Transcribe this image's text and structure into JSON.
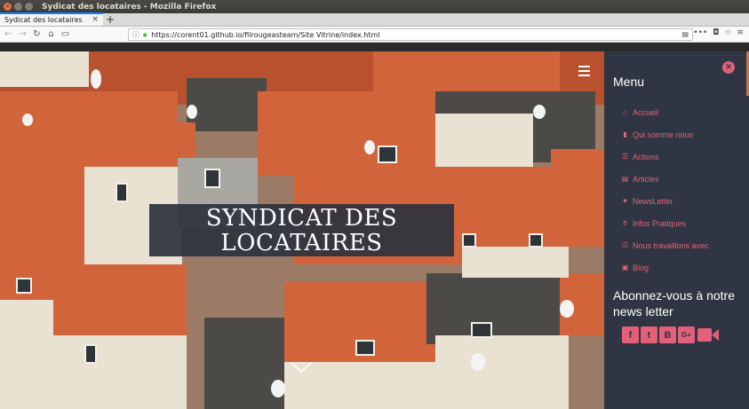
{
  "window": {
    "title": "Sydicat des locataires - Mozilla Firefox"
  },
  "tabs": [
    {
      "label": "Sydicat des locataires",
      "active": true
    }
  ],
  "navbar": {
    "url": "https://corent01.github.io/filrougeasteam/Site Vitrine/index.html",
    "overflow_label": "•••"
  },
  "hero": {
    "title_line1": "SYNDICAT DES",
    "title_line2": "LOCATAIRES"
  },
  "sidebar": {
    "heading": "Menu",
    "items": [
      {
        "icon": "home-icon",
        "label": "Accueil"
      },
      {
        "icon": "bookmark-icon",
        "label": "Qui somme nous"
      },
      {
        "icon": "list-icon",
        "label": "Actions"
      },
      {
        "icon": "newspaper-icon",
        "label": "Articles"
      },
      {
        "icon": "heart-icon",
        "label": "NewsLetter"
      },
      {
        "icon": "thumbs-up-icon",
        "label": "Infos Pratiques"
      },
      {
        "icon": "checkbox-icon",
        "label": "Nous travaillons avec"
      },
      {
        "icon": "blogger-icon",
        "label": "Blog"
      }
    ],
    "newsletter_heading": "Abonnez-vous à notre news letter",
    "social": [
      {
        "icon": "facebook-icon",
        "glyph": "f"
      },
      {
        "icon": "twitter-icon",
        "glyph": "t"
      },
      {
        "icon": "blogger-icon",
        "glyph": "B"
      },
      {
        "icon": "google-plus-icon",
        "glyph": "G+"
      },
      {
        "icon": "video-icon",
        "glyph": ""
      }
    ]
  },
  "colors": {
    "accent": "#e4607a",
    "sidebar_bg": "#2f3542",
    "title_box_bg": "#2d323e",
    "firefox_tab_accent": "#0a84ff"
  }
}
